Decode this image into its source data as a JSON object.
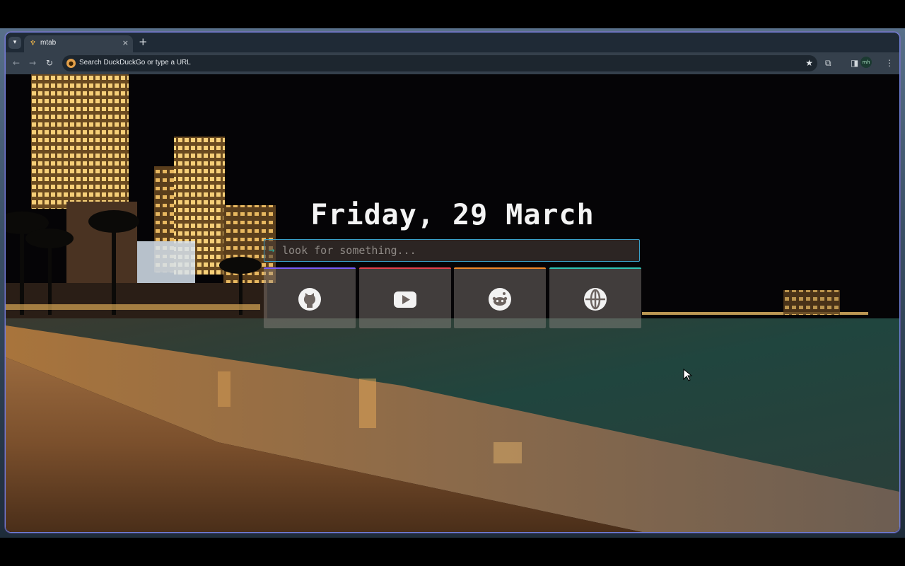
{
  "browser": {
    "tab_title": "mtab",
    "tab_close_glyph": "×",
    "new_tab_glyph": "+",
    "omnibox_placeholder": "Search DuckDuckGo or type a URL",
    "avatar_text": "mh"
  },
  "page": {
    "date_text": "Friday, 29 March",
    "search": {
      "prompt_glyph": "→",
      "placeholder": "look for something..."
    },
    "links": [
      {
        "name": "github",
        "icon": "github-icon",
        "accent": "#7b5cf5"
      },
      {
        "name": "youtube",
        "icon": "youtube-icon",
        "accent": "#e5404a"
      },
      {
        "name": "reddit",
        "icon": "reddit-icon",
        "accent": "#f0882a"
      },
      {
        "name": "web",
        "icon": "globe-icon",
        "accent": "#2fc3b3"
      }
    ]
  },
  "colors": {
    "accent_border": "#3aa0c8",
    "window_frame": "#6f7fd8",
    "tab_strip": "#1f2a36",
    "toolbar": "#35404c"
  }
}
